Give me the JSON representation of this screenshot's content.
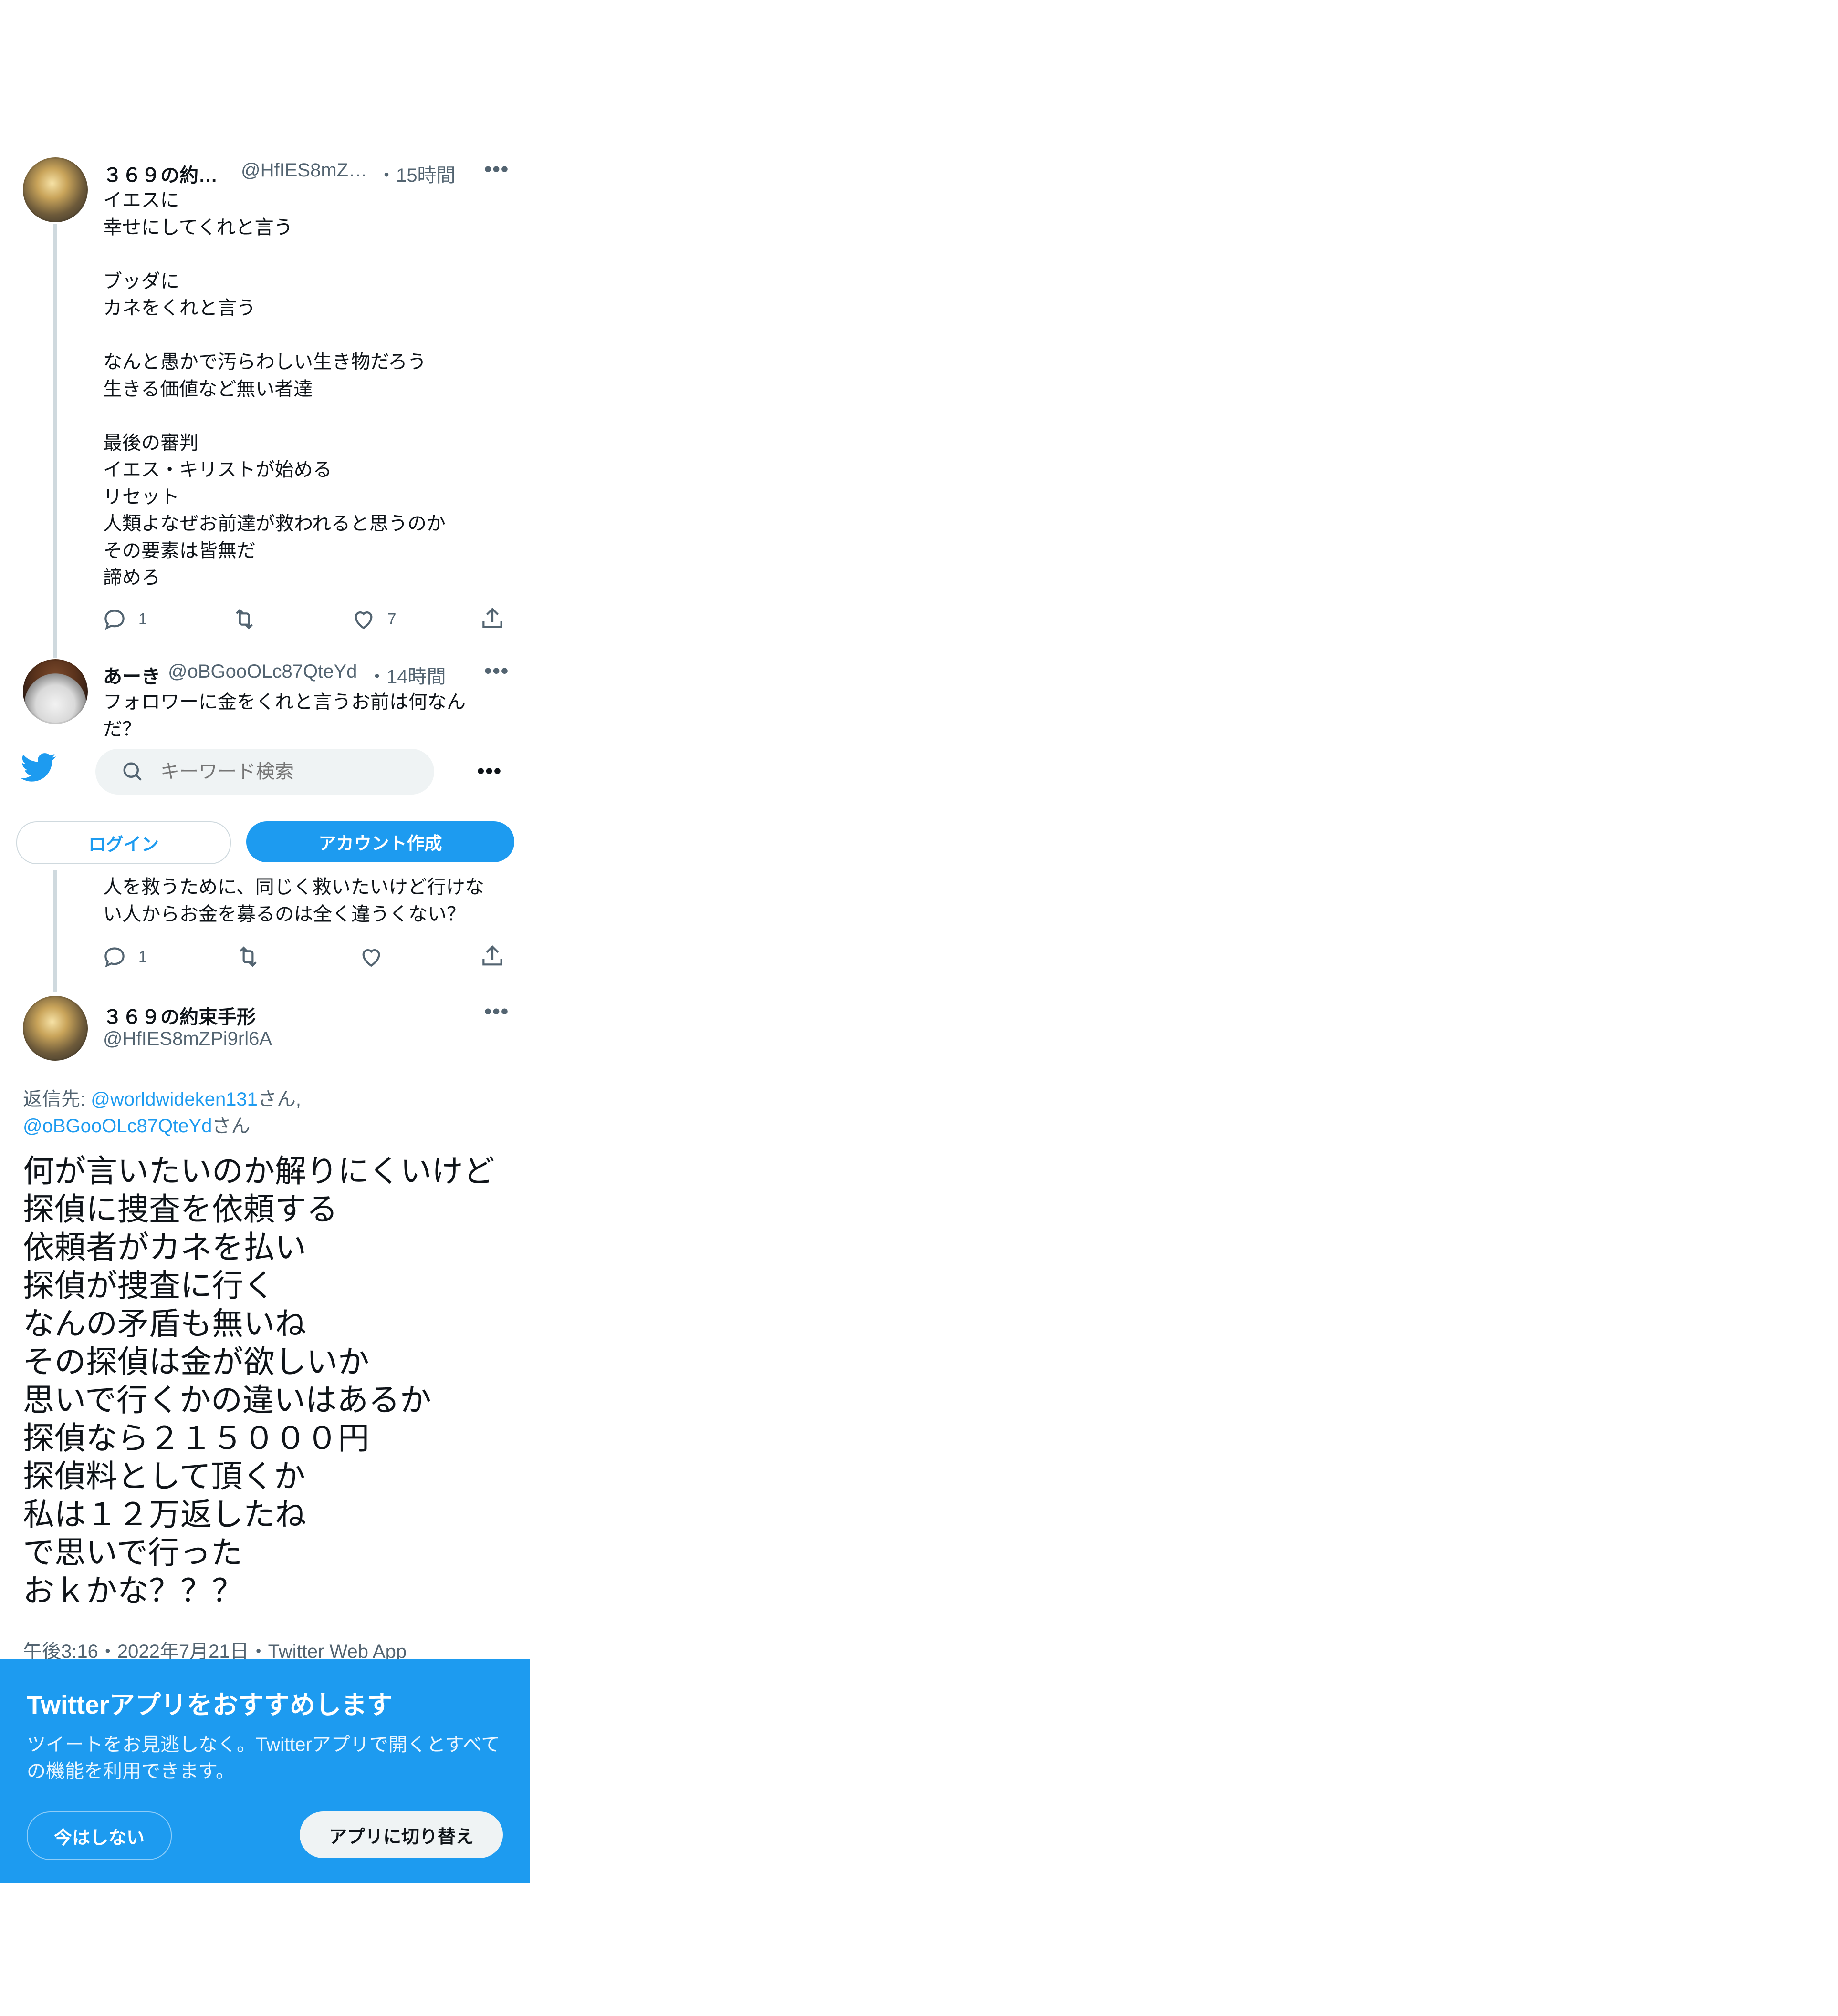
{
  "tweet1": {
    "name": "３６９の約…",
    "handle": "@HfIES8mZ…",
    "time": "・15時間",
    "more": "•••",
    "text": "イエスに\n幸せにしてくれと言う\n\nブッダに\nカネをくれと言う\n\nなんと愚かで汚らわしい生き物だろう\n生きる価値など無い者達\n\n最後の審判\nイエス・キリストが始める\nリセット\n人類よなぜお前達が救われると思うのか\nその要素は皆無だ\n諦めろ",
    "reply_count": "1",
    "like_count": "7"
  },
  "tweet2": {
    "name": "あーき",
    "handle": "@oBGooOLc87QteYd",
    "time": "・14時間",
    "more": "•••",
    "text_top": "フォロワーに金をくれと言うお前は何なん\nだ？",
    "text_bottom": "人を救うために、同じく救いたいけど行けな\nい人からお金を募るのは全く違うくない？",
    "reply_count": "1"
  },
  "nav": {
    "search_placeholder": "キーワード検索",
    "more": "•••",
    "login_label": "ログイン",
    "signup_label": "アカウント作成"
  },
  "main_tweet": {
    "name": "３６９の約束手形",
    "handle": "@HfIES8mZPi9rl6A",
    "more": "•••",
    "reply_prefix": "返信先: ",
    "reply_to_1": "@worldwideken131",
    "reply_suffix_1": "さん,",
    "reply_to_2": "@oBGooOLc87QteYd",
    "reply_suffix_2": "さん",
    "text": "何が言いたいのか解りにくいけど\n探偵に捜査を依頼する\n依頼者がカネを払い\n探偵が捜査に行く\nなんの矛盾も無いね\nその探偵は金が欲しいか\n思いで行くかの違いはあるか\n探偵なら２１５０００円\n探偵料として頂くか\n私は１２万返したね\nで思いで行った\nおｋかな？？？",
    "timestamp": "午後3:16・2022年7月21日・Twitter Web App"
  },
  "banner": {
    "title": "Twitterアプリをおすすめします",
    "description": "ツイートをお見逃しなく。Twitterアプリで開くとすべての機能を利用できます。",
    "later_label": "今はしない",
    "switch_label": "アプリに切り替え"
  },
  "colors": {
    "accent": "#1d9bf0",
    "muted": "#536471",
    "thread_line": "#cfd9de"
  }
}
